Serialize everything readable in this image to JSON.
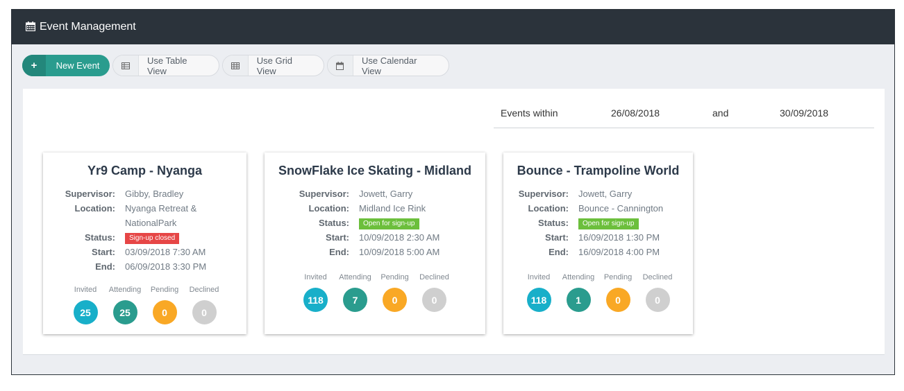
{
  "header": {
    "title": "Event Management",
    "icon": "calendar-icon"
  },
  "toolbar": {
    "new_event": "New Event",
    "table_view": "Use Table View",
    "grid_view": "Use Grid View",
    "calendar_view": "Use Calendar View"
  },
  "filter": {
    "label": "Events within",
    "start": "26/08/2018",
    "and": "and",
    "end": "30/09/2018"
  },
  "labels": {
    "supervisor": "Supervisor:",
    "location": "Location:",
    "status": "Status:",
    "start": "Start:",
    "end": "End:",
    "invited": "Invited",
    "attending": "Attending",
    "pending": "Pending",
    "declined": "Declined"
  },
  "events": [
    {
      "title": "Yr9 Camp - Nyanga",
      "supervisor": "Gibby, Bradley",
      "location_line1": "Nyanga Retreat &",
      "location_line2": "NationalPark",
      "status": "Sign-up closed",
      "start": "03/09/2018 7:30 AM",
      "end": "06/09/2018 3:30 PM",
      "invited": "25",
      "attending": "25",
      "pending": "0",
      "declined": "0"
    },
    {
      "title": "SnowFlake Ice Skating - Midland",
      "supervisor": "Jowett, Garry",
      "location_line1": "Midland Ice Rink",
      "status": "Open for sign-up",
      "start": "10/09/2018 2:30 AM",
      "end": "10/09/2018 5:00 AM",
      "invited": "118",
      "attending": "7",
      "pending": "0",
      "declined": "0"
    },
    {
      "title": "Bounce - Trampoline World",
      "supervisor": "Jowett, Garry",
      "location_line1": "Bounce - Cannington",
      "status": "Open for sign-up",
      "start": "16/09/2018 1:30 PM",
      "end": "16/09/2018 4:00 PM",
      "invited": "118",
      "attending": "1",
      "pending": "0",
      "declined": "0"
    }
  ],
  "colors": {
    "header": "#2b333b",
    "primary": "#2a9c8e",
    "invited": "#18afc9",
    "pending": "#f9a825",
    "declined": "#cfcfcf",
    "closed": "#e64646",
    "open": "#6cbf3c"
  }
}
